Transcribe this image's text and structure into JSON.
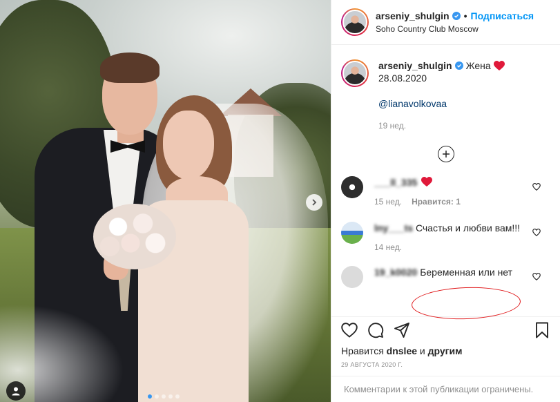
{
  "post": {
    "slider_dots": [
      true,
      false,
      false,
      false,
      false
    ]
  },
  "header": {
    "username": "arseniy_shulgin",
    "follow_label": "Подписаться",
    "location": "Soho Country Club Moscow"
  },
  "caption": {
    "username": "arseniy_shulgin",
    "text": "Жена",
    "date_line": "28.08.2020",
    "mention": "@lianavolkovaa",
    "time_ago": "19 нед."
  },
  "load_more_icon": "plus-circle-icon",
  "comments": [
    {
      "username": "___ll_335",
      "text": "",
      "has_heart_emoji": true,
      "time_ago": "15 нед.",
      "likes_label": "Нравится: 1",
      "avatar_color": "#2d2d2d"
    },
    {
      "username": "lny___ts",
      "text": "Счастья и любви вам!!!",
      "time_ago": "14 нед.",
      "likes_label": "",
      "avatar_color": "#3a7bd5"
    },
    {
      "username": "19_k0020",
      "text": "Беременная или нет",
      "time_ago": "",
      "likes_label": "",
      "avatar_color": "#dbdbdb"
    }
  ],
  "actions": {
    "like_icon": "heart-icon",
    "comment_icon": "comment-icon",
    "share_icon": "paper-plane-icon",
    "save_icon": "bookmark-icon"
  },
  "likes": {
    "prefix": "Нравится",
    "user": "dnslee",
    "conj": "и",
    "others": "другим"
  },
  "date": "29 августа 2020 г.",
  "footer": {
    "comments_disabled": "Комментарии к этой публикации ограничены."
  },
  "colors": {
    "accent": "#0095f6",
    "verified": "#3897f0",
    "heart": "#ed4956",
    "annotation": "#e0191b"
  }
}
